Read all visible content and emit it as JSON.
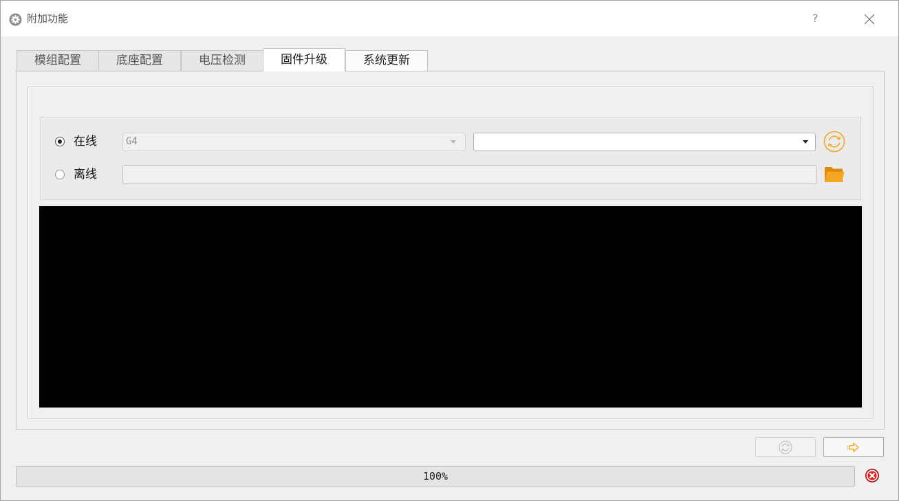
{
  "window": {
    "title": "附加功能",
    "help_label": "?"
  },
  "tabs": [
    {
      "label": "模组配置",
      "selected": false
    },
    {
      "label": "底座配置",
      "selected": false
    },
    {
      "label": "电压检测",
      "selected": false
    },
    {
      "label": "固件升级",
      "selected": true
    },
    {
      "label": "系统更新",
      "selected": false
    }
  ],
  "firmware_upgrade": {
    "online": {
      "label": "在线",
      "checked": true,
      "device_select": {
        "value": "G4",
        "enabled": false
      },
      "version_select": {
        "value": "",
        "enabled": true
      }
    },
    "offline": {
      "label": "离线",
      "checked": false,
      "file_path": {
        "value": ""
      }
    }
  },
  "actions": {
    "reload_button": {
      "enabled": false
    },
    "next_button": {
      "enabled": true
    }
  },
  "progress": {
    "value": 100,
    "text": "100%"
  },
  "icons": {
    "title": "gear-icon",
    "close": "close-icon",
    "dropdown": "chevron-down-icon",
    "refresh": "refresh-icon",
    "browse": "folder-open-icon",
    "next": "arrow-right-icon",
    "cancel": "cancel-icon"
  },
  "colors": {
    "accent": "#f5a623",
    "accent_dark": "#e08a0b",
    "danger": "#e32222",
    "log_background": "#000000"
  }
}
